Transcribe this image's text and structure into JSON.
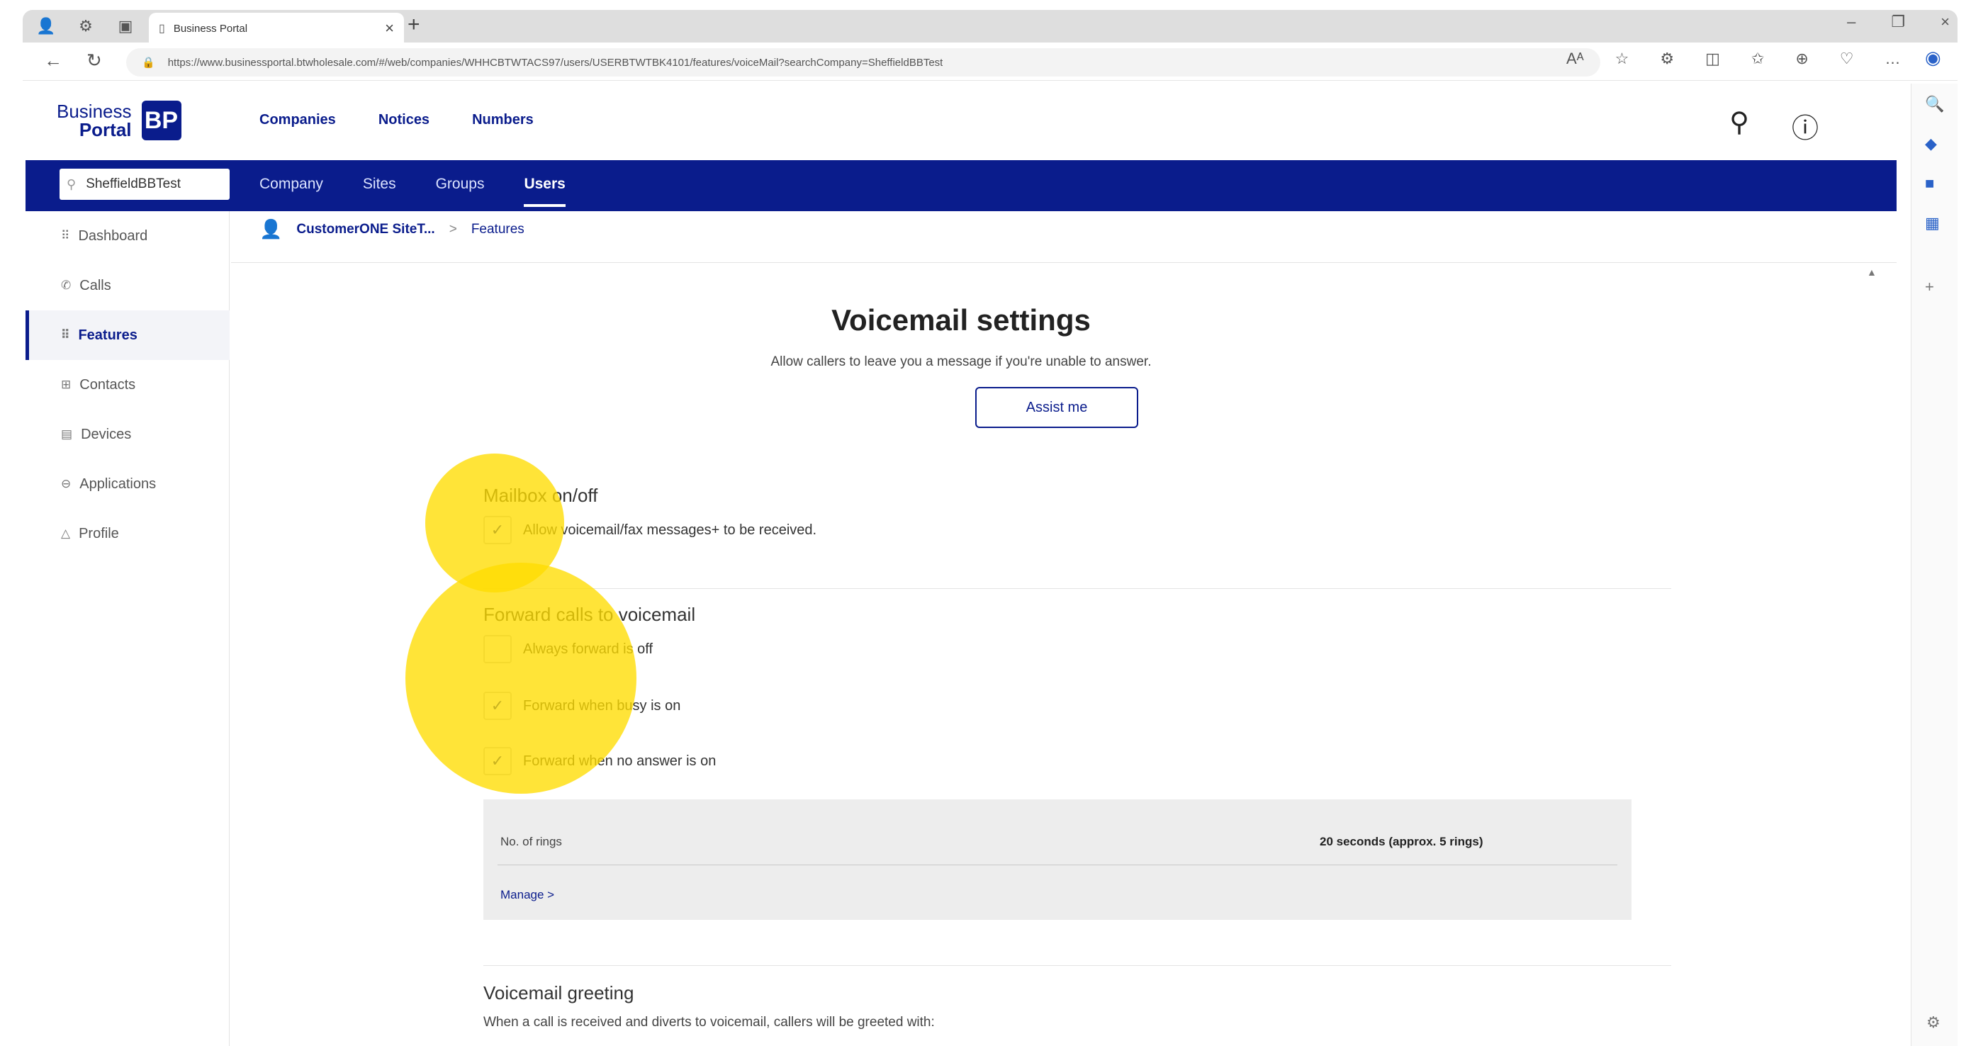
{
  "browser": {
    "tab_title": "Business Portal",
    "url": "https://www.businessportal.btwholesale.com/#/web/companies/WHHCBTWTACS97/users/USERBTWTBK4101/features/voiceMail?searchCompany=SheffieldBBTest"
  },
  "header": {
    "logo_line1": "Business",
    "logo_line2": "Portal",
    "logo_mark": "BP",
    "nav": [
      "Companies",
      "Notices",
      "Numbers"
    ]
  },
  "subnav": {
    "company_search_value": "SheffieldBBTest",
    "items": [
      "Company",
      "Sites",
      "Groups",
      "Users"
    ],
    "active": "Users"
  },
  "sidebar": {
    "items": [
      {
        "label": "Dashboard",
        "icon": "grid-icon"
      },
      {
        "label": "Calls",
        "icon": "phone-icon"
      },
      {
        "label": "Features",
        "icon": "grid-icon",
        "active": true
      },
      {
        "label": "Contacts",
        "icon": "contacts-icon"
      },
      {
        "label": "Devices",
        "icon": "device-icon"
      },
      {
        "label": "Applications",
        "icon": "apps-icon"
      },
      {
        "label": "Profile",
        "icon": "profile-icon"
      }
    ]
  },
  "breadcrumb": {
    "user": "CustomerONE SiteT...",
    "separator": ">",
    "current": "Features"
  },
  "main": {
    "title": "Voicemail settings",
    "subtitle": "Allow callers to leave you a message if you're unable to answer.",
    "assist_label": "Assist me",
    "mailbox": {
      "title": "Mailbox on/off",
      "option": "Allow voicemail/fax messages+ to be received.",
      "checked": true
    },
    "forward": {
      "title": "Forward calls to voicemail",
      "options": [
        {
          "label": "Always forward is off",
          "checked": false
        },
        {
          "label": "Forward when busy is on",
          "checked": true
        },
        {
          "label": "Forward when no answer is on",
          "checked": true
        }
      ]
    },
    "rings": {
      "label": "No. of rings",
      "value": "20 seconds (approx. 5 rings)",
      "manage": "Manage >"
    },
    "greeting": {
      "title": "Voicemail greeting",
      "desc": "When a call is received and diverts to voicemail, callers will be greeted with:"
    }
  },
  "colors": {
    "brand": "#0a1c8c",
    "highlight": "#ffdc00"
  }
}
